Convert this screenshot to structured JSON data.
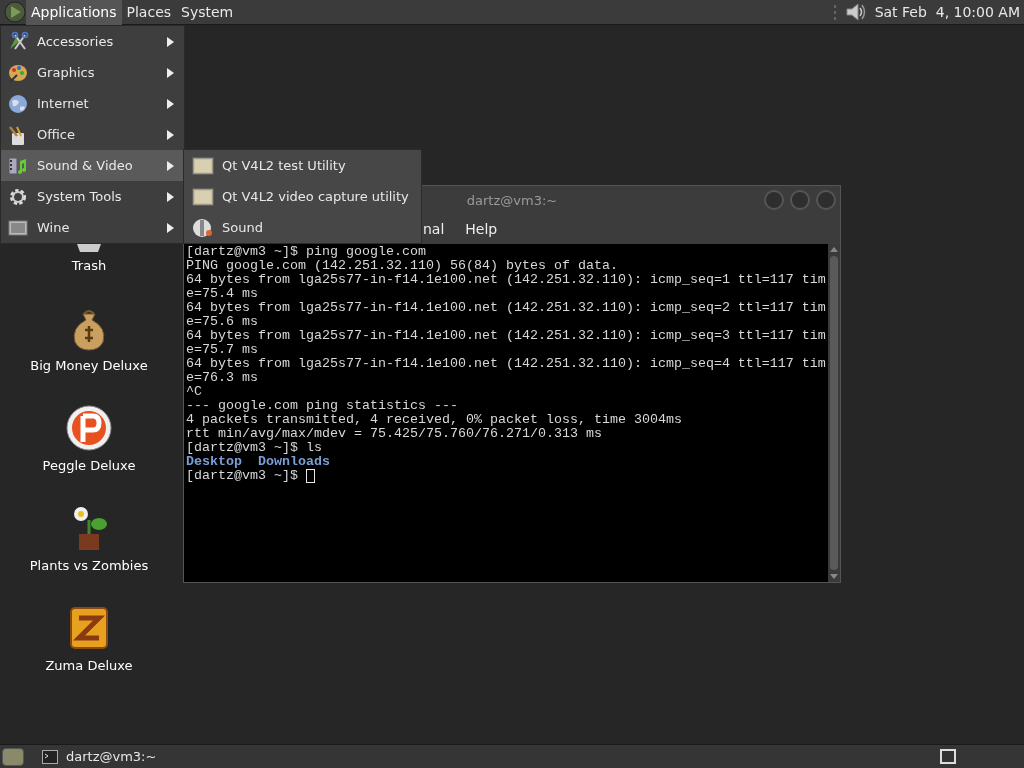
{
  "top_panel": {
    "menus": [
      {
        "label": "Applications",
        "selected": true
      },
      {
        "label": "Places",
        "selected": false
      },
      {
        "label": "System",
        "selected": false
      }
    ],
    "clock": "Sat Feb  4, 10:00 AM"
  },
  "applications_menu": {
    "items": [
      {
        "label": "Accessories",
        "selected": false
      },
      {
        "label": "Graphics",
        "selected": false
      },
      {
        "label": "Internet",
        "selected": false
      },
      {
        "label": "Office",
        "selected": false
      },
      {
        "label": "Sound & Video",
        "selected": true
      },
      {
        "label": "System Tools",
        "selected": false
      },
      {
        "label": "Wine",
        "selected": false
      }
    ],
    "submenu": {
      "items": [
        {
          "label": "Qt V4L2 test Utility",
          "kind": "app"
        },
        {
          "label": "Qt V4L2 video capture utility",
          "kind": "app"
        },
        {
          "label": "Sound",
          "kind": "sound"
        }
      ]
    }
  },
  "desktop_icons": [
    {
      "label": "Trash",
      "kind": "trash"
    },
    {
      "label": "Big Money Deluxe",
      "kind": "money"
    },
    {
      "label": "Peggle Deluxe",
      "kind": "peggle"
    },
    {
      "label": "Plants vs Zombies",
      "kind": "plants"
    },
    {
      "label": "Zuma Deluxe",
      "kind": "zuma"
    }
  ],
  "terminal": {
    "title": "dartz@vm3:~",
    "menu": [
      "nal",
      "Help"
    ],
    "lines": [
      {
        "text": "[dartz@vm3 ~]$ ping google.com",
        "kind": "output"
      },
      {
        "text": "PING google.com (142.251.32.110) 56(84) bytes of data.",
        "kind": "output"
      },
      {
        "text": "64 bytes from lga25s77-in-f14.1e100.net (142.251.32.110): icmp_seq=1 ttl=117 tim",
        "kind": "output"
      },
      {
        "text": "e=75.4 ms",
        "kind": "output"
      },
      {
        "text": "64 bytes from lga25s77-in-f14.1e100.net (142.251.32.110): icmp_seq=2 ttl=117 tim",
        "kind": "output"
      },
      {
        "text": "e=75.6 ms",
        "kind": "output"
      },
      {
        "text": "64 bytes from lga25s77-in-f14.1e100.net (142.251.32.110): icmp_seq=3 ttl=117 tim",
        "kind": "output"
      },
      {
        "text": "e=75.7 ms",
        "kind": "output"
      },
      {
        "text": "64 bytes from lga25s77-in-f14.1e100.net (142.251.32.110): icmp_seq=4 ttl=117 tim",
        "kind": "output"
      },
      {
        "text": "e=76.3 ms",
        "kind": "output"
      },
      {
        "text": "^C",
        "kind": "output"
      },
      {
        "text": "--- google.com ping statistics ---",
        "kind": "output"
      },
      {
        "text": "4 packets transmitted, 4 received, 0% packet loss, time 3004ms",
        "kind": "output"
      },
      {
        "text": "rtt min/avg/max/mdev = 75.425/75.760/76.271/0.313 ms",
        "kind": "output"
      },
      {
        "text": "[dartz@vm3 ~]$ ls",
        "kind": "output"
      },
      {
        "text": "Desktop  Downloads",
        "kind": "directory"
      },
      {
        "text": "[dartz@vm3 ~]$ ",
        "kind": "prompt"
      }
    ]
  },
  "bottom_panel": {
    "tasks": [
      {
        "label": "dartz@vm3:~"
      }
    ]
  }
}
